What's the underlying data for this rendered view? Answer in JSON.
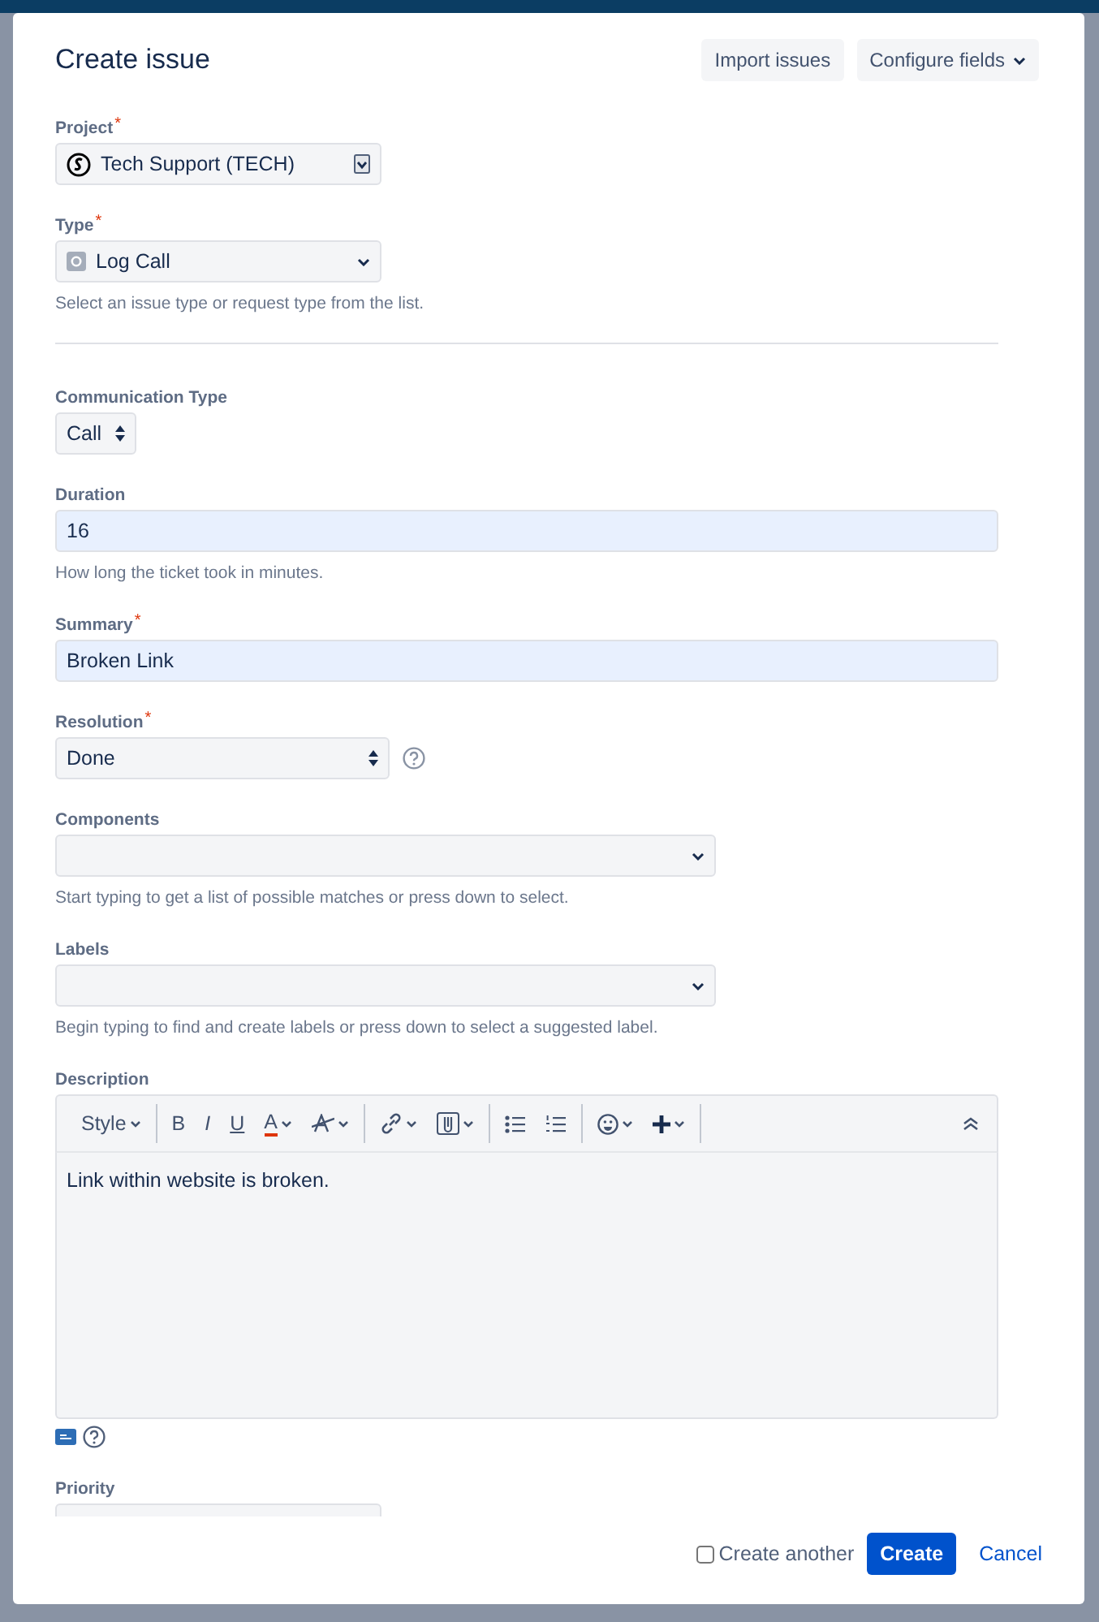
{
  "dialog": {
    "title": "Create issue"
  },
  "header_buttons": [
    {
      "label": "Import issues",
      "menu": false
    },
    {
      "label": "Configure fields",
      "menu": true
    }
  ],
  "fields": [
    {
      "kind": "project",
      "label": "Project",
      "required_mark": "*",
      "value": "Tech Support (TECH)"
    },
    {
      "kind": "type",
      "label": "Type",
      "required_mark": "*",
      "value": "Log Call",
      "hint": "Select an issue type or request type from the list."
    },
    {
      "kind": "divider"
    },
    {
      "kind": "picker",
      "label": "Communication Type",
      "value": "Call"
    },
    {
      "kind": "text",
      "label": "Duration",
      "value": "16",
      "hint": "How long the ticket took in minutes."
    },
    {
      "kind": "text",
      "label": "Summary",
      "required_mark": "*",
      "value": "Broken Link"
    },
    {
      "kind": "spinner",
      "label": "Resolution",
      "required_mark": "*",
      "value": "Done",
      "help": true
    },
    {
      "kind": "multi",
      "label": "Components",
      "hint": "Start typing to get a list of possible matches or press down to select."
    },
    {
      "kind": "multi",
      "label": "Labels",
      "hint": "Begin typing to find and create labels or press down to select a suggested label."
    },
    {
      "kind": "editor",
      "label": "Description",
      "value": "Link within website is broken.",
      "toolbar": [
        [
          {
            "kind": "style",
            "label": "Style"
          }
        ],
        [
          {
            "kind": "bold",
            "label": "B"
          },
          {
            "kind": "italic",
            "label": "I"
          },
          {
            "kind": "underline",
            "label": "U"
          },
          {
            "kind": "color",
            "label": "A",
            "color": "#de350b"
          },
          {
            "kind": "format"
          }
        ],
        [
          {
            "kind": "link"
          },
          {
            "kind": "attach"
          }
        ],
        [
          {
            "kind": "bullets"
          },
          {
            "kind": "numbers"
          }
        ],
        [
          {
            "kind": "emoji"
          },
          {
            "kind": "insert"
          }
        ]
      ]
    },
    {
      "kind": "cut",
      "label": "Priority"
    }
  ],
  "footer": {
    "create_another": {
      "label": "Create another",
      "checked": false
    },
    "buttons": [
      {
        "label": "Create",
        "kind": "primary"
      },
      {
        "label": "Cancel",
        "kind": "link"
      }
    ]
  }
}
